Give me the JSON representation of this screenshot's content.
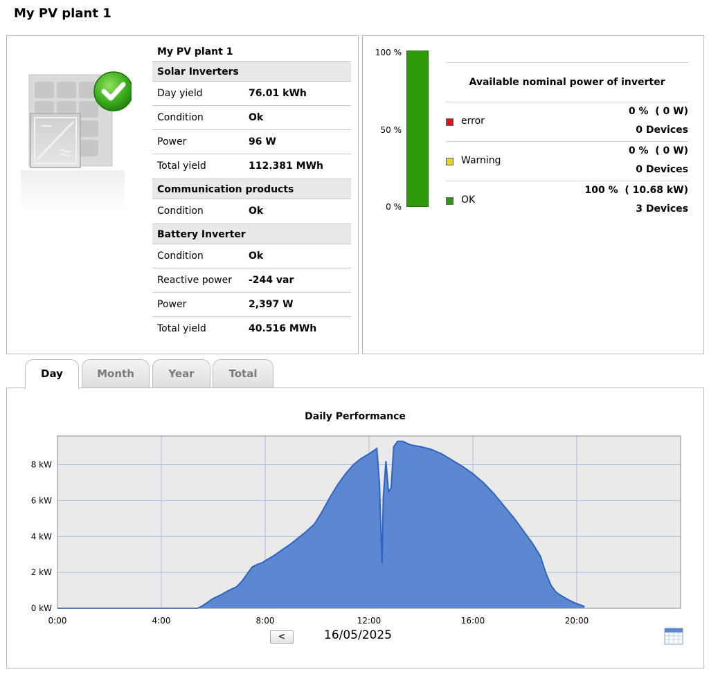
{
  "page": {
    "title": "My PV plant 1"
  },
  "info": {
    "plant_name": "My PV plant 1",
    "solar": {
      "title": "Solar Inverters",
      "rows": [
        {
          "label": "Day yield",
          "value": "76.01 kWh"
        },
        {
          "label": "Condition",
          "value": "Ok"
        },
        {
          "label": "Power",
          "value": "96 W"
        },
        {
          "label": "Total yield",
          "value": "112.381 MWh"
        }
      ]
    },
    "comm": {
      "title": "Communication products",
      "rows": [
        {
          "label": "Condition",
          "value": "Ok"
        }
      ]
    },
    "battery": {
      "title": "Battery Inverter",
      "rows": [
        {
          "label": "Condition",
          "value": "Ok"
        },
        {
          "label": "Reactive power",
          "value": "-244 var"
        },
        {
          "label": "Power",
          "value": "2,397 W"
        },
        {
          "label": "Total yield",
          "value": "40.516 MWh"
        }
      ]
    }
  },
  "nominal": {
    "title": "Available nominal power of inverter",
    "gauge_labels": [
      "100 %",
      "50 %",
      "0 %"
    ],
    "ok_fraction": 1.0,
    "statuses": [
      {
        "label": "error",
        "percent": "0 %  ( 0 W)",
        "devices": "0 Devices",
        "color": "#e3121c"
      },
      {
        "label": "Warning",
        "percent": "0 %  ( 0 W)",
        "devices": "0 Devices",
        "color": "#e8d31a"
      },
      {
        "label": "OK",
        "percent": "100 %  ( 10.68 kW)",
        "devices": "3 Devices",
        "color": "#2e9a0a"
      }
    ]
  },
  "tabs": [
    {
      "label": "Day",
      "active": true
    },
    {
      "label": "Month",
      "active": false
    },
    {
      "label": "Year",
      "active": false
    },
    {
      "label": "Total",
      "active": false
    }
  ],
  "chart": {
    "date": "16/05/2025",
    "prev_label": "<",
    "icon": "calendar-icon"
  },
  "chart_data": {
    "type": "area",
    "title": "Daily Performance",
    "xlabel": "",
    "ylabel": "",
    "x_ticks": [
      "0:00",
      "4:00",
      "8:00",
      "12:00",
      "16:00",
      "20:00"
    ],
    "y_ticks": [
      "0 kW",
      "2 kW",
      "4 kW",
      "6 kW",
      "8 kW"
    ],
    "xlim": [
      0,
      24
    ],
    "ylim": [
      0,
      9.6
    ],
    "grid": true,
    "fill_color": "#5b88d0",
    "line_color": "#2f63c2",
    "series": [
      {
        "x": [
          0,
          5.4,
          5.6,
          5.8,
          6.0,
          6.3,
          6.6,
          6.9,
          7.1,
          7.3,
          7.5,
          7.7,
          7.9,
          8.0,
          8.3,
          8.6,
          9.0,
          9.3,
          9.6,
          9.9,
          10.2,
          10.5,
          10.8,
          11.1,
          11.4,
          11.7,
          12.0,
          12.2,
          12.3,
          12.4,
          12.5,
          12.55,
          12.65,
          12.75,
          12.85,
          12.95,
          13.1,
          13.3,
          13.6,
          14.0,
          14.4,
          14.8,
          15.2,
          15.6,
          16.0,
          16.4,
          16.8,
          17.2,
          17.6,
          18.0,
          18.3,
          18.6,
          18.8,
          19.0,
          19.2,
          19.4,
          19.7,
          20.0,
          20.2,
          20.3
        ],
        "y": [
          0,
          0,
          0.15,
          0.35,
          0.55,
          0.75,
          1.0,
          1.2,
          1.5,
          1.9,
          2.3,
          2.45,
          2.55,
          2.65,
          2.9,
          3.2,
          3.6,
          3.95,
          4.3,
          4.7,
          5.4,
          6.2,
          6.9,
          7.5,
          8.0,
          8.35,
          8.6,
          8.8,
          8.9,
          7.0,
          2.5,
          6.2,
          8.2,
          6.5,
          6.7,
          9.0,
          9.3,
          9.3,
          9.1,
          9.0,
          8.85,
          8.6,
          8.25,
          7.9,
          7.5,
          7.0,
          6.4,
          5.7,
          5.0,
          4.2,
          3.6,
          2.9,
          2.0,
          1.3,
          0.9,
          0.7,
          0.45,
          0.25,
          0.15,
          0.1
        ]
      }
    ]
  }
}
